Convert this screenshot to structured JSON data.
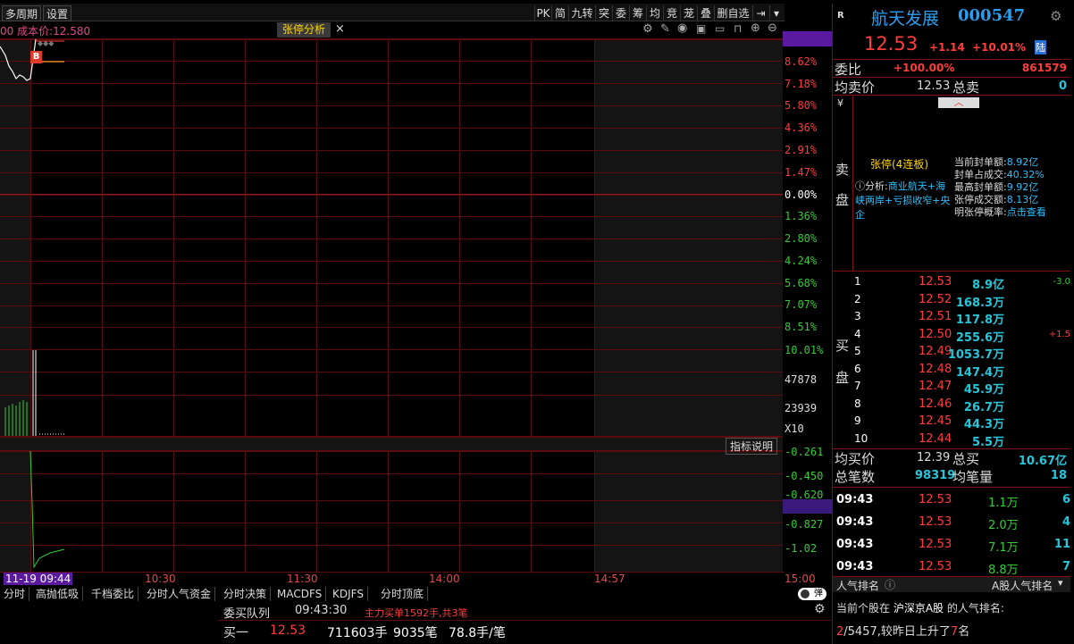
{
  "toolbar": {
    "multi_period": "多周期",
    "settings": "设置",
    "right_buttons": [
      "PK",
      "简",
      "九转",
      "突",
      "委",
      "筹",
      "均",
      "竞",
      "茏",
      "叠",
      "删自选"
    ]
  },
  "chart_header": {
    "cost_label": "00 成本价:12.580",
    "limit_tab": "张停分析",
    "close": "×"
  },
  "right_axis": {
    "price": [
      "10.01%",
      "8.62%",
      "7.18%",
      "5.80%",
      "4.36%",
      "2.91%",
      "1.47%",
      "0.00%",
      "1.36%",
      "2.80%",
      "4.24%",
      "5.68%",
      "7.07%",
      "8.51%",
      "10.01%"
    ],
    "volume": [
      "47878",
      "23939",
      "X10"
    ],
    "indicator": [
      "-0.261",
      "-0.450",
      "-0.620",
      "-0.702",
      "-0.827",
      "-1.02"
    ]
  },
  "indicator_label": "指标说明",
  "buy_marker": "B",
  "time_axis": {
    "start": "11-19 09:44",
    "labels": [
      "10:30",
      "11:30",
      "14:00",
      "14:57",
      "15:00"
    ]
  },
  "bottom_tabs": [
    "分时",
    "高抛低吸",
    "千档委比",
    "分时人气资金",
    "分时决策",
    "MACDFS",
    "KDJFS",
    "分时顶底"
  ],
  "queue": {
    "title": "委买队列",
    "time": "09:43:30",
    "note": "主力买单1592手,共3笔",
    "side": "买一",
    "price": "12.53",
    "volume": "711603手",
    "count": "9035笔",
    "avg": "78.8手/笔"
  },
  "toggle_label": "弹",
  "stock": {
    "market_tag": "R",
    "name": "航天发展",
    "code": "000547",
    "price": "12.53",
    "change": "+1.14",
    "pct": "+10.01%",
    "badge": "陆"
  },
  "stats": {
    "ratio_label": "委比",
    "ratio_pct": "+100.00%",
    "ratio_val": "861579",
    "avg_sell_label": "均卖价",
    "avg_sell": "12.53",
    "total_sell_label": "总卖",
    "total_sell": "0"
  },
  "sell_panel": {
    "yen": "¥",
    "side_label": [
      "卖",
      "盘"
    ],
    "status": "张停(4连板)",
    "analysis_prefix": "ⓘ分析:",
    "analysis": "商业航天+海峡两岸+亏损收窄+央企",
    "metrics": [
      {
        "label": "当前封单额:",
        "value": "8.92亿"
      },
      {
        "label": "封单占成交:",
        "value": "40.32%"
      },
      {
        "label": "最高封单额:",
        "value": "9.92亿"
      },
      {
        "label": "张停成交额:",
        "value": "8.13亿"
      },
      {
        "label": "明张停概率:",
        "value": "点击查看"
      }
    ]
  },
  "buy_side_label": [
    "买",
    "盘"
  ],
  "bids": [
    {
      "level": "1",
      "price": "12.53",
      "vol": "8.9亿",
      "diff": "-3.0"
    },
    {
      "level": "2",
      "price": "12.52",
      "vol": "168.3万",
      "diff": ""
    },
    {
      "level": "3",
      "price": "12.51",
      "vol": "117.8万",
      "diff": ""
    },
    {
      "level": "4",
      "price": "12.50",
      "vol": "255.6万",
      "diff": "+1.5"
    },
    {
      "level": "5",
      "price": "12.49",
      "vol": "1053.7万",
      "diff": ""
    },
    {
      "level": "6",
      "price": "12.48",
      "vol": "147.4万",
      "diff": ""
    },
    {
      "level": "7",
      "price": "12.47",
      "vol": "45.9万",
      "diff": ""
    },
    {
      "level": "8",
      "price": "12.46",
      "vol": "26.7万",
      "diff": ""
    },
    {
      "level": "9",
      "price": "12.45",
      "vol": "44.3万",
      "diff": ""
    },
    {
      "level": "10",
      "price": "12.44",
      "vol": "5.5万",
      "diff": ""
    }
  ],
  "buy_stats": {
    "avg_buy_label": "均买价",
    "avg_buy": "12.39",
    "total_buy_label": "总买",
    "total_buy": "10.67亿",
    "trades_label": "总笔数",
    "trades": "98319",
    "avg_vol_label": "均笔量",
    "avg_vol": "18"
  },
  "ticks": [
    {
      "time": "09:43",
      "price": "12.53",
      "vol": "1.1万",
      "n": "6"
    },
    {
      "time": "09:43",
      "price": "12.53",
      "vol": "2.0万",
      "n": "4"
    },
    {
      "time": "09:43",
      "price": "12.53",
      "vol": "7.1万",
      "n": "11"
    },
    {
      "time": "09:43",
      "price": "12.53",
      "vol": "8.8万",
      "n": "7"
    }
  ],
  "popularity": {
    "title": "人气排名",
    "dropdown": "A股人气排名",
    "line1_a": "当前个股在",
    "line1_b": "沪深京A股",
    "line1_c": "的人气排名:",
    "rank": "2",
    "total": "/5457,",
    "line2_mid": "较昨日上升了",
    "delta": "7",
    "line2_end": "名"
  }
}
